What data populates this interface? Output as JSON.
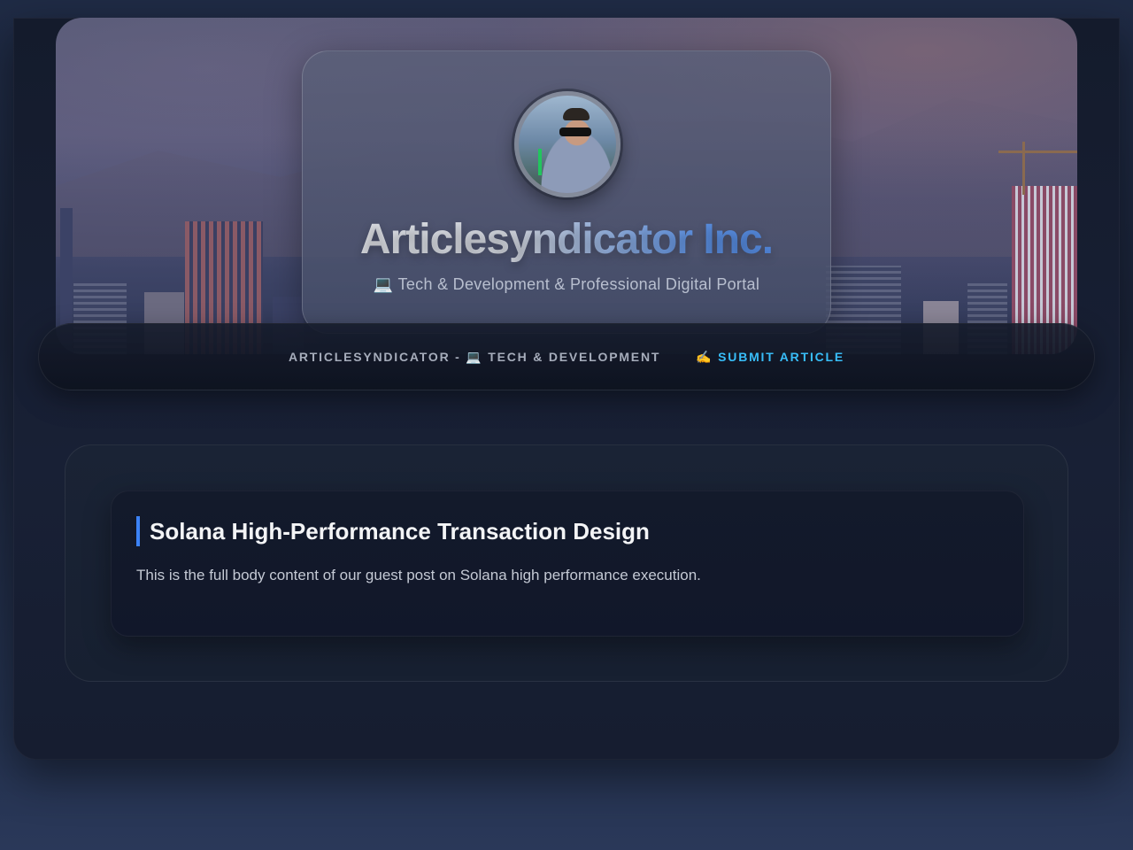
{
  "header": {
    "site_title": "Articlesyndicator Inc.",
    "subtitle": "💻 Tech & Development & Professional Digital Portal",
    "avatar_icon": "profile-photo"
  },
  "nav": {
    "items": [
      {
        "label": "ARTICLESYNDICATOR - 💻 TECH & DEVELOPMENT"
      },
      {
        "label": "✍️ SUBMIT ARTICLE"
      }
    ]
  },
  "article": {
    "title": "Solana High-Performance Transaction Design",
    "body": "This is the full body content of our guest post on Solana high performance execution."
  },
  "colors": {
    "accent": "#38bdf8",
    "title_bar": "#3b82f6",
    "background": "#1a2338"
  }
}
